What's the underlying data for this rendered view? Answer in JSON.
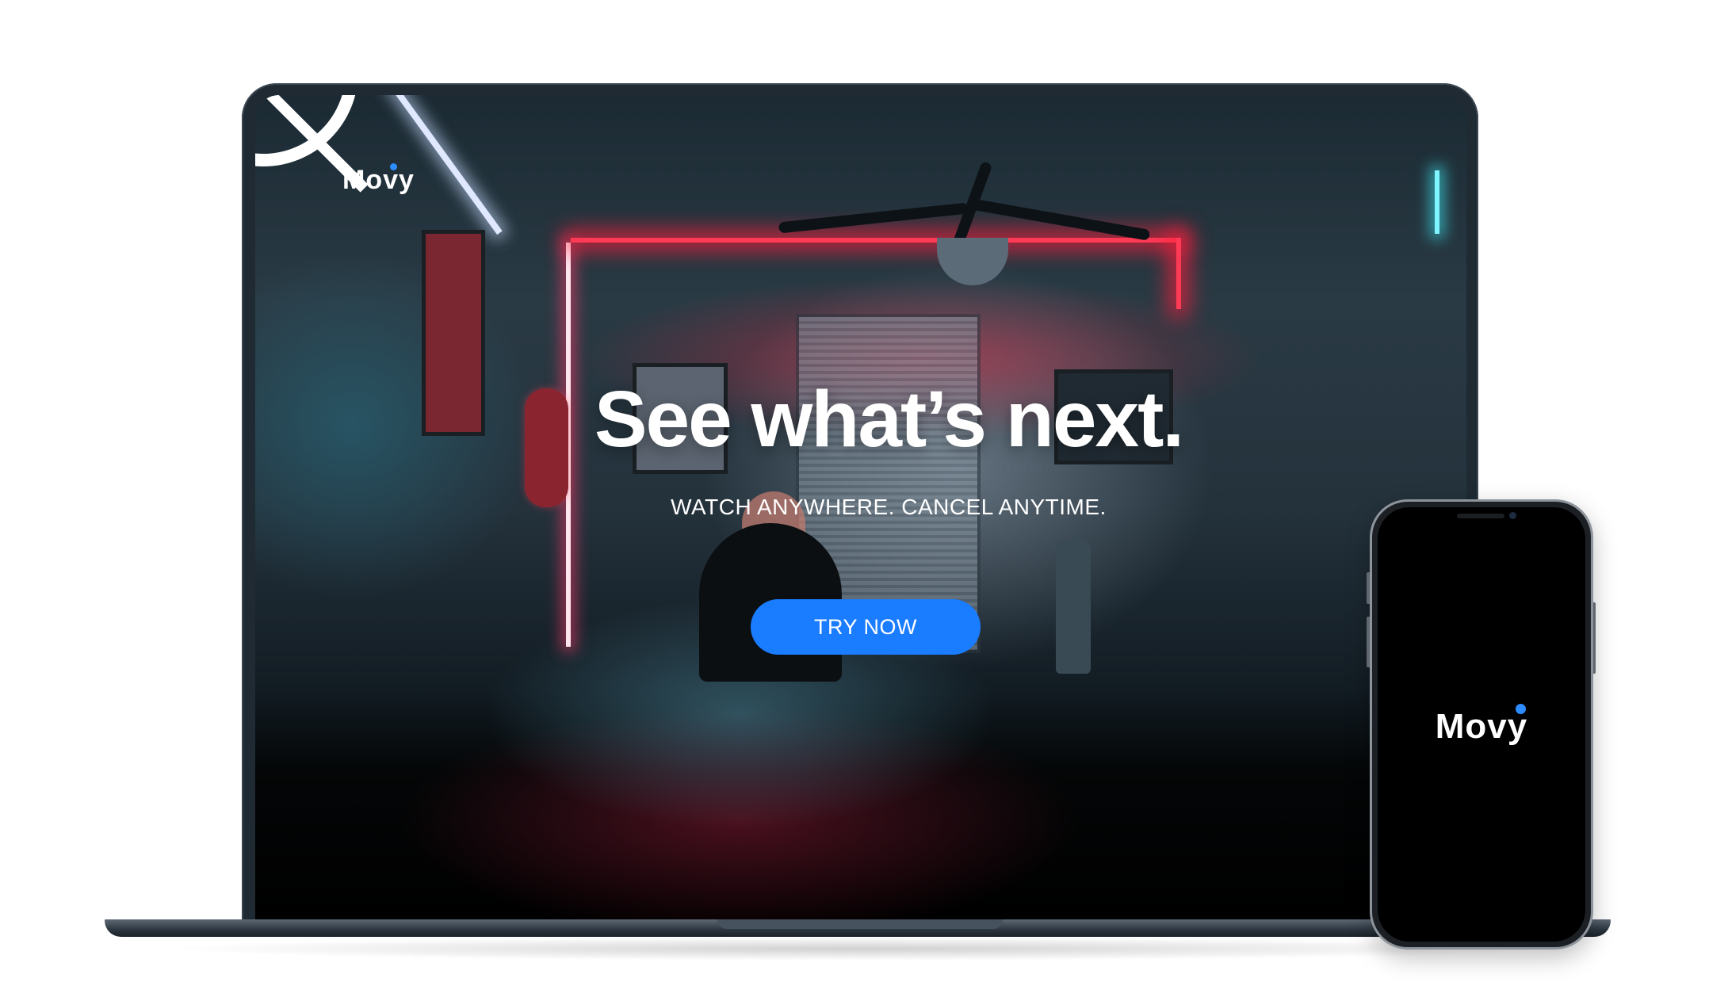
{
  "brand": {
    "name": "Movy",
    "accent_color": "#1a7cff"
  },
  "hero": {
    "title": "See what’s next.",
    "subtitle": "WATCH ANYWHERE. CANCEL ANYTIME.",
    "cta_label": "TRY NOW"
  },
  "phone": {
    "splash_logo": "Movy"
  }
}
